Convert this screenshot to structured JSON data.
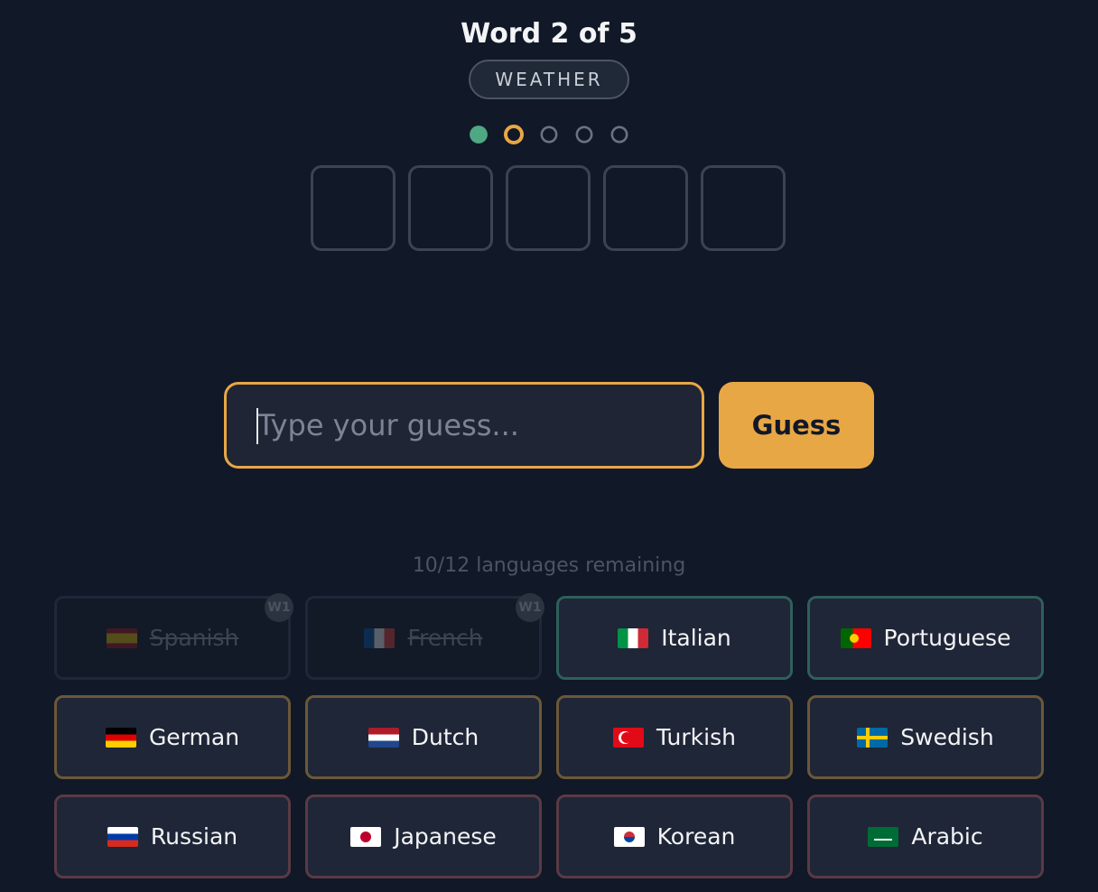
{
  "header": {
    "title": "Word 2 of 5",
    "category": "WEATHER"
  },
  "progress": {
    "current_word": 2,
    "total_words": 5,
    "dots": [
      "done",
      "current",
      "pending",
      "pending",
      "pending"
    ]
  },
  "answer_slots": {
    "count": 5,
    "letters": [
      "",
      "",
      "",
      "",
      ""
    ]
  },
  "guess": {
    "placeholder": "Type your guess...",
    "value": "",
    "button_label": "Guess"
  },
  "languages": {
    "remaining_text": "10/12 languages remaining",
    "items": [
      {
        "name": "Spanish",
        "flag": "spain-flag-icon",
        "used": true,
        "badge": "W1",
        "tier": "green"
      },
      {
        "name": "French",
        "flag": "france-flag-icon",
        "used": true,
        "badge": "W1",
        "tier": "green"
      },
      {
        "name": "Italian",
        "flag": "italy-flag-icon",
        "used": false,
        "tier": "green"
      },
      {
        "name": "Portuguese",
        "flag": "portugal-flag-icon",
        "used": false,
        "tier": "green"
      },
      {
        "name": "German",
        "flag": "germany-flag-icon",
        "used": false,
        "tier": "amber"
      },
      {
        "name": "Dutch",
        "flag": "netherlands-flag-icon",
        "used": false,
        "tier": "amber"
      },
      {
        "name": "Turkish",
        "flag": "turkey-flag-icon",
        "used": false,
        "tier": "amber"
      },
      {
        "name": "Swedish",
        "flag": "sweden-flag-icon",
        "used": false,
        "tier": "amber"
      },
      {
        "name": "Russian",
        "flag": "russia-flag-icon",
        "used": false,
        "tier": "red"
      },
      {
        "name": "Japanese",
        "flag": "japan-flag-icon",
        "used": false,
        "tier": "red"
      },
      {
        "name": "Korean",
        "flag": "south-korea-flag-icon",
        "used": false,
        "tier": "red"
      },
      {
        "name": "Arabic",
        "flag": "saudi-arabia-flag-icon",
        "used": false,
        "tier": "red"
      }
    ]
  },
  "colors": {
    "background": "#111827",
    "accent": "#e8a745",
    "success": "#4fa884",
    "tier_green_border": "#2f5f5a",
    "tier_amber_border": "#6b5838",
    "tier_red_border": "#5a3a44"
  }
}
